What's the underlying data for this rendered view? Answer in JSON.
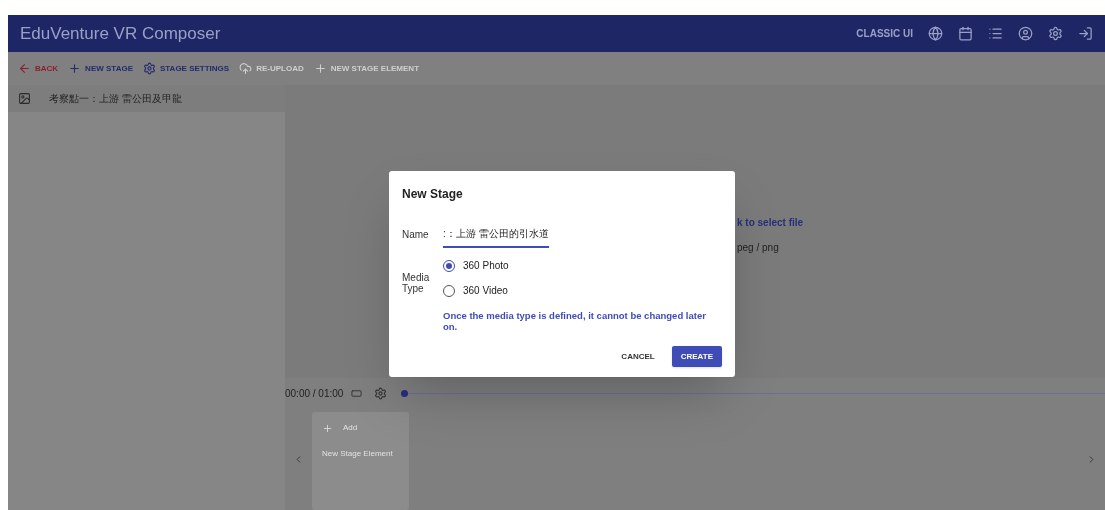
{
  "app_bar": {
    "title": "EduVenture VR Composer",
    "classic_ui": "CLASSIC UI"
  },
  "toolbar": [
    {
      "label": "BACK",
      "kind": "back",
      "disabled": false
    },
    {
      "label": "NEW STAGE",
      "kind": "add",
      "disabled": false
    },
    {
      "label": "STAGE SETTINGS",
      "kind": "settings",
      "disabled": false
    },
    {
      "label": "RE-UPLOAD",
      "kind": "upload",
      "disabled": true
    },
    {
      "label": "NEW STAGE ELEMENT",
      "kind": "add",
      "disabled": true
    }
  ],
  "stages": [
    {
      "title": "考察點一：上游 雷公田及甲龍"
    }
  ],
  "dropzone": {
    "hint": "k to select file",
    "formats": "peg / png"
  },
  "timeline": {
    "time": "00:00 / 01:00",
    "level": 0
  },
  "add_card": {
    "action": "Add",
    "label": "New Stage Element"
  },
  "dialog": {
    "title": "New Stage",
    "name_label": "Name",
    "name_value": ":：上游 雷公田的引水道",
    "media_type_label": "Media Type",
    "options": [
      {
        "label": "360 Photo",
        "selected": true
      },
      {
        "label": "360 Video",
        "selected": false
      }
    ],
    "warning": "Once the media type is defined, it cannot be changed later on.",
    "buttons": [
      {
        "label": "CANCEL",
        "kind": "text"
      },
      {
        "label": "CREATE",
        "kind": "primary"
      }
    ]
  }
}
